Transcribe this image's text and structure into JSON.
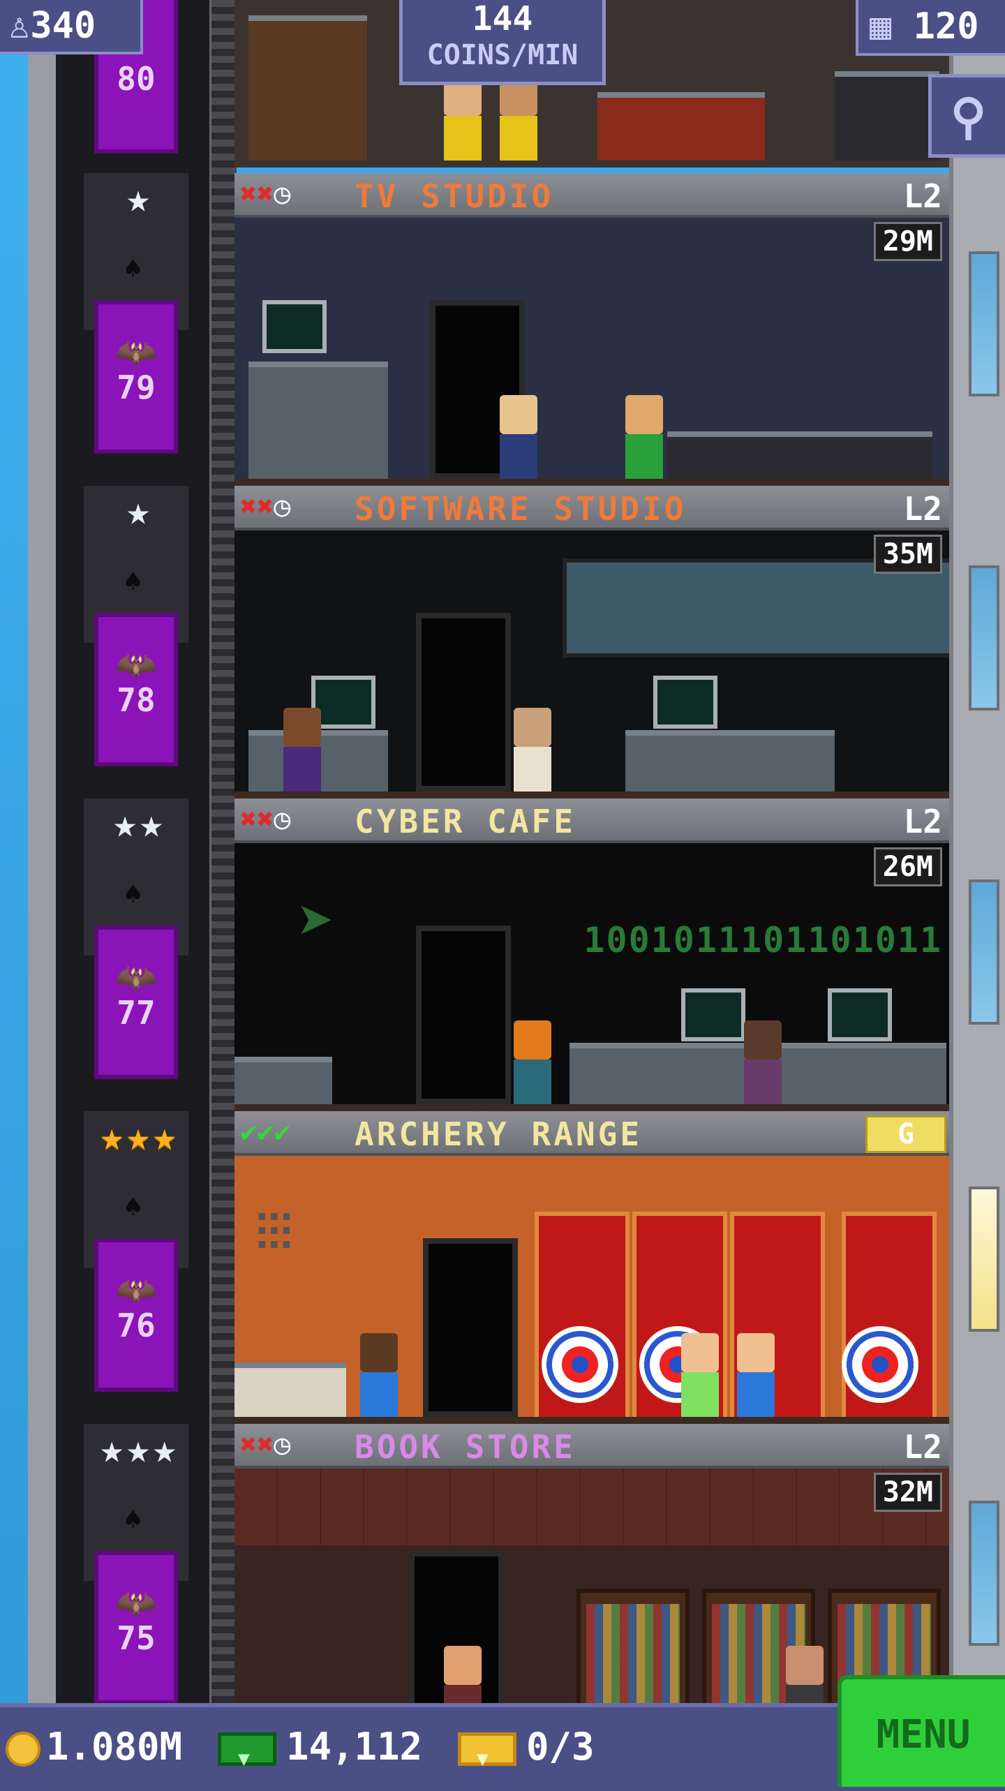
{
  "hud": {
    "population": "340",
    "coin_rate_value": "144",
    "coin_rate_unit": "COINS/MIN",
    "floor_count": "120",
    "icons": {
      "population": "person-up-icon",
      "floors": "building-icon",
      "search": "magnifier-icon"
    }
  },
  "elevator": {
    "top_floor": "80",
    "cars": [
      "79",
      "78",
      "77",
      "76",
      "75"
    ]
  },
  "floors": [
    {
      "name": "TV STUDIO",
      "name_color": "#f07a3a",
      "level": "L2",
      "timer": "29M",
      "status": [
        "x",
        "x",
        "clock"
      ],
      "stars": "silver",
      "star_count": 1
    },
    {
      "name": "SOFTWARE STUDIO",
      "name_color": "#f07a3a",
      "level": "L2",
      "timer": "35M",
      "status": [
        "x",
        "x",
        "clock"
      ],
      "stars": "silver",
      "star_count": 1
    },
    {
      "name": "CYBER CAFE",
      "name_color": "#f3e6a0",
      "level": "L2",
      "timer": "26M",
      "status": [
        "x",
        "x",
        "clock"
      ],
      "stars": "silver",
      "star_count": 2,
      "binary_text": "1001011101101011"
    },
    {
      "name": "ARCHERY RANGE",
      "name_color": "#f3e6a0",
      "badge": "G",
      "status": [
        "ok",
        "ok",
        "ok"
      ],
      "stars": "gold",
      "star_count": 3
    },
    {
      "name": "BOOK STORE",
      "name_color": "#d98ae8",
      "level": "L2",
      "timer": "32M",
      "status": [
        "x",
        "x",
        "clock"
      ],
      "stars": "silver",
      "star_count": 3
    }
  ],
  "bottom_bar": {
    "coins": "1.080M",
    "bux": "14,112",
    "tickets": "0/3",
    "menu_label": "MENU"
  }
}
